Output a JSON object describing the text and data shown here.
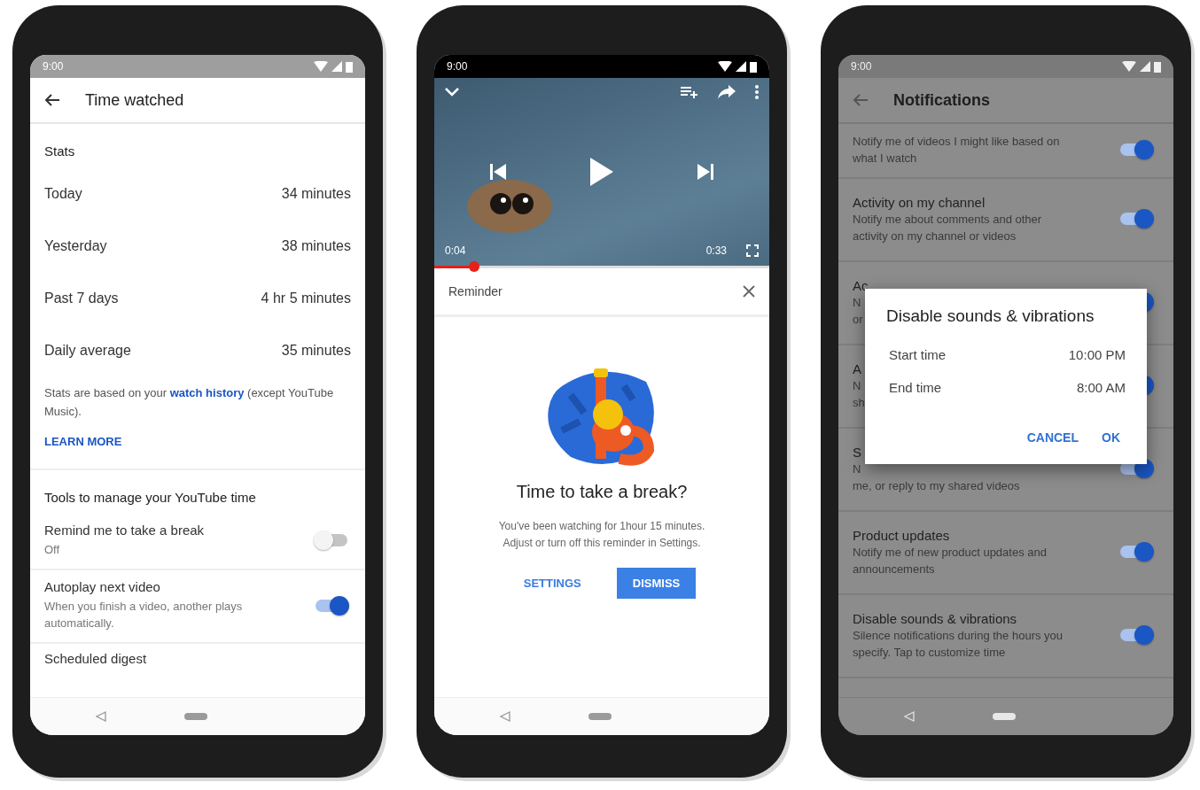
{
  "phones": [
    {
      "kind": "stats",
      "status_time": "9:00",
      "title": "Time watched",
      "section": "Stats",
      "stats": [
        {
          "label": "Today",
          "value": "34 minutes"
        },
        {
          "label": "Yesterday",
          "value": "38 minutes"
        },
        {
          "label": "Past 7 days",
          "value": "4 hr 5 minutes"
        },
        {
          "label": "Daily average",
          "value": "35 minutes"
        }
      ],
      "note": {
        "before": "Stats are based on your ",
        "link": "watch history",
        "after": " (except YouTube Music)."
      },
      "learn_more": "LEARN MORE",
      "tools_heading": "Tools to manage your YouTube time",
      "settings": [
        {
          "title": "Remind me to take a break",
          "subtitle": "Off",
          "on": false
        },
        {
          "title": "Autoplay next video",
          "subtitle": "When you finish a video, another plays automatically.",
          "on": true
        }
      ],
      "cut_item": "Scheduled digest"
    },
    {
      "kind": "player",
      "status_time": "9:00",
      "video": {
        "elapsed": "0:04",
        "duration": "0:33",
        "level": 0.12
      },
      "sheet_title": "Reminder",
      "heading": "Time to take a break?",
      "message": [
        "You've been watching for 1hour 15 minutes.",
        "Adjust or turn off this reminder in Settings."
      ],
      "buttons": [
        {
          "label": "SETTINGS",
          "kind": "text"
        },
        {
          "label": "DISMISS",
          "kind": "filled"
        }
      ]
    },
    {
      "kind": "notifications",
      "status_time": "9:00",
      "title": "Notifications",
      "rows": [
        {
          "lines": [
            "Notify me of videos I might like based on",
            "what I watch"
          ],
          "on": true
        },
        {
          "title": "Activity on my channel",
          "lines": [
            "Notify me about comments and other",
            "activity on my channel or videos"
          ],
          "on": true
        },
        {
          "title": "Ac",
          "lines": [
            "N",
            "or"
          ],
          "on": true
        },
        {
          "title": "A",
          "lines": [
            "N",
            "sh"
          ],
          "on": true
        },
        {
          "title": "S",
          "lines": [
            "N",
            "me, or reply to my shared videos"
          ],
          "on": true
        },
        {
          "title": "Product updates",
          "lines": [
            "Notify me of new product updates and",
            "announcements"
          ],
          "on": true
        },
        {
          "title": "Disable sounds & vibrations",
          "lines": [
            "Silence notifications during the hours you",
            "specify.  Tap to customize time"
          ],
          "on": true
        }
      ],
      "dialog": {
        "title": "Disable sounds & vibrations",
        "times": [
          {
            "label": "Start time",
            "value": "10:00 PM"
          },
          {
            "label": "End time",
            "value": "8:00 AM"
          }
        ],
        "buttons": [
          "CANCEL",
          "OK"
        ]
      }
    }
  ]
}
